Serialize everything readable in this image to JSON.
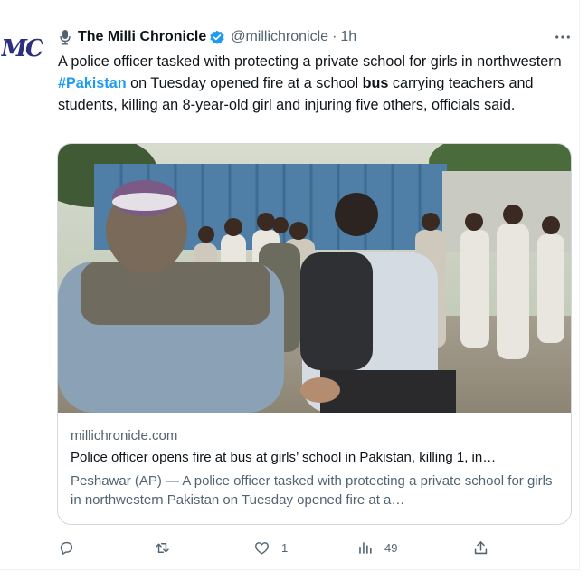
{
  "tweet": {
    "author_name": "The Milli Chronicle",
    "handle": "@millichronicle",
    "separator": "·",
    "time": "1h",
    "avatar_text": "MC",
    "text_parts": [
      "A police officer tasked with protecting a private school for girls in northwestern ",
      "#Pakistan",
      " on Tuesday opened fire at a school ",
      "bus",
      " carrying teachers and students, killing an 8-year-old girl and injuring five others, officials said."
    ]
  },
  "card": {
    "domain": "millichronicle.com",
    "title": "Police officer opens fire at bus at girls’ school in Pakistan, killing 1, in…",
    "description": "Peshawar (AP) — A police officer tasked with protecting a private school for girls in northwestern Pakistan on Tuesday opened fire at a…"
  },
  "actions": {
    "reply_count": "",
    "retweet_count": "",
    "like_count": "1",
    "views_count": "49"
  },
  "colors": {
    "link": "#1d9bf0",
    "secondary_text": "#536471",
    "border": "#cfd9de",
    "verified": "#1d9bf0"
  },
  "icons": [
    "microphone-icon",
    "verified-badge-icon",
    "more-icon",
    "reply-icon",
    "retweet-icon",
    "like-icon",
    "views-icon",
    "share-icon"
  ]
}
